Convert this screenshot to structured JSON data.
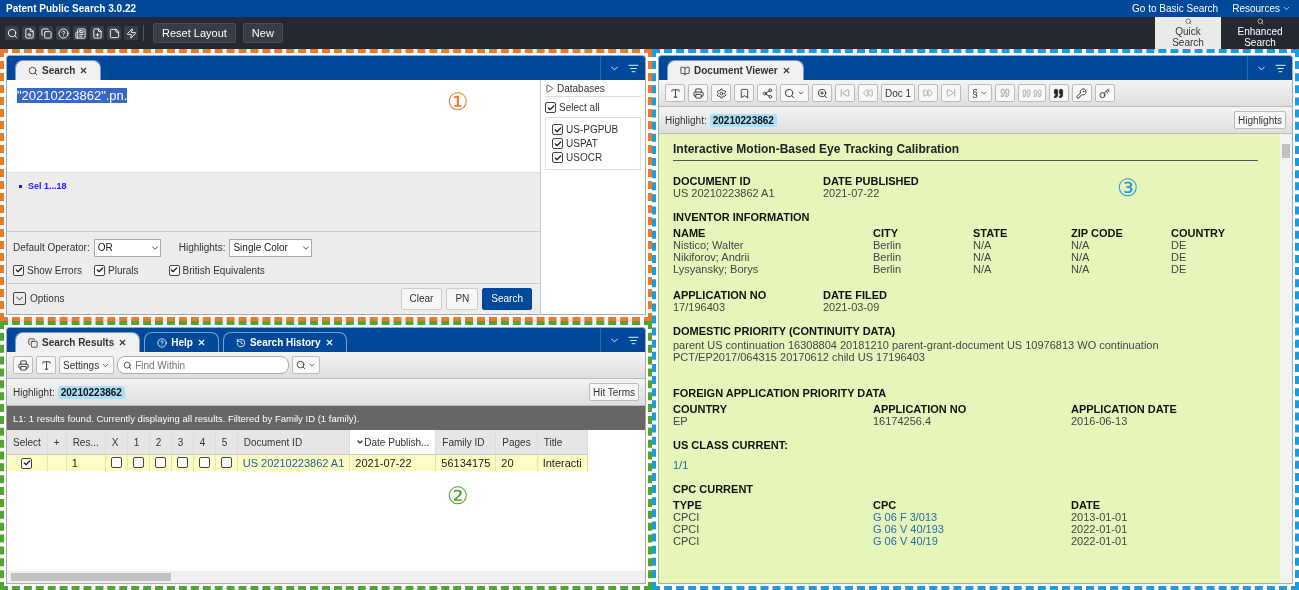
{
  "app": {
    "title": "Patent Public Search 3.0.22",
    "links": [
      "Go to Basic Search",
      "Resources"
    ]
  },
  "toolbar": {
    "buttons": [
      "Reset Layout",
      "New"
    ],
    "modes": [
      {
        "label": "Quick Search",
        "selected": true
      },
      {
        "label": "Enhanced Search",
        "selected": false
      }
    ]
  },
  "search_panel": {
    "marker": "①",
    "tabs": [
      {
        "label": "Search",
        "selected": true
      }
    ],
    "query": "\"20210223862\".pn.",
    "sets": [
      "Sel 1...18"
    ],
    "default_operator": {
      "label": "Default Operator:",
      "value": "OR"
    },
    "highlights": {
      "label": "Highlights:",
      "value": "Single Color"
    },
    "options": [
      {
        "label": "Show Errors",
        "checked": true
      },
      {
        "label": "Plurals",
        "checked": true
      },
      {
        "label": "British Equivalents",
        "checked": true
      }
    ],
    "options_toggle": "Options",
    "buttons": [
      {
        "label": "Clear",
        "primary": false
      },
      {
        "label": "PN",
        "primary": false
      },
      {
        "label": "Search",
        "primary": true
      }
    ],
    "databases": {
      "title": "Databases",
      "select_all": {
        "label": "Select all",
        "checked": true
      },
      "items": [
        {
          "label": "US-PGPUB",
          "checked": true
        },
        {
          "label": "USPAT",
          "checked": true
        },
        {
          "label": "USOCR",
          "checked": true
        }
      ]
    }
  },
  "results_panel": {
    "marker": "②",
    "tabs": [
      {
        "label": "Search Results",
        "selected": true
      },
      {
        "label": "Help",
        "selected": false
      },
      {
        "label": "Search History",
        "selected": false
      }
    ],
    "settings": "Settings",
    "find_placeholder": "Find Within",
    "highlight_label": "Highlight:",
    "highlight_term": "20210223862",
    "hit_terms": "Hit Terms",
    "status": "L1:  1 results found. Currently displaying all results. Filtered by Family ID (1 family).",
    "columns": [
      {
        "label": "Select",
        "sorted": false
      },
      {
        "label": "+",
        "sorted": false
      },
      {
        "label": "Res...",
        "sorted": false
      },
      {
        "label": "X",
        "sorted": false
      },
      {
        "label": "1",
        "sorted": false
      },
      {
        "label": "2",
        "sorted": false
      },
      {
        "label": "3",
        "sorted": false
      },
      {
        "label": "4",
        "sorted": false
      },
      {
        "label": "5",
        "sorted": false
      },
      {
        "label": "Document ID",
        "sorted": false
      },
      {
        "label": "Date Publish...",
        "sorted": true
      },
      {
        "label": "Family ID",
        "sorted": false
      },
      {
        "label": "Pages",
        "sorted": false
      },
      {
        "label": "Title",
        "sorted": false
      }
    ],
    "rows": [
      {
        "selected": true,
        "checked": true,
        "result": "1",
        "marks": [
          false,
          false,
          false,
          false,
          false,
          false
        ],
        "document_id": "US 20210223862 A1",
        "date": "2021-07-22",
        "family_id": "56134175",
        "pages": "20",
        "title": "Interacti"
      }
    ]
  },
  "viewer": {
    "marker": "③",
    "tabs": [
      {
        "label": "Document Viewer",
        "selected": true
      }
    ],
    "doc": "Doc 1",
    "section_menu": "§",
    "highlight_label": "Highlight:",
    "highlight_term": "20210223862",
    "highlights_button": "Highlights",
    "title": "Interactive Motion-Based Eye Tracking Calibration",
    "sections": [
      {
        "kind": "fields",
        "items": [
          {
            "label": "DOCUMENT ID",
            "value": "US 20210223862 A1"
          },
          {
            "label": "DATE PUBLISHED",
            "value": "2021-07-22"
          }
        ]
      },
      {
        "kind": "table",
        "title": "INVENTOR INFORMATION",
        "columns": [
          "NAME",
          "CITY",
          "STATE",
          "ZIP CODE",
          "COUNTRY"
        ],
        "rows": [
          [
            "Nistico; Walter",
            "Berlin",
            "N/A",
            "N/A",
            "DE"
          ],
          [
            "Nikiforov; Andrii",
            "Berlin",
            "N/A",
            "N/A",
            "DE"
          ],
          [
            "Lysyansky; Borys",
            "Berlin",
            "N/A",
            "N/A",
            "DE"
          ]
        ]
      },
      {
        "kind": "fields",
        "items": [
          {
            "label": "APPLICATION NO",
            "value": "17/196403"
          },
          {
            "label": "DATE FILED",
            "value": "2021-03-09"
          }
        ]
      },
      {
        "kind": "paragraph",
        "title": "DOMESTIC PRIORITY (CONTINUITY DATA)",
        "text": "parent US continuation 16308804 20181210 parent-grant-document US 10976813 WO continuation PCT/EP2017/064315 20170612 child US 17196403"
      },
      {
        "kind": "table",
        "title": "FOREIGN APPLICATION PRIORITY DATA",
        "columns": [
          "COUNTRY",
          "APPLICATION NO",
          "APPLICATION DATE"
        ],
        "rows": [
          [
            "EP",
            "16174256.4",
            "2016-06-13"
          ]
        ]
      },
      {
        "kind": "link",
        "title": "US CLASS CURRENT:",
        "text": "1/1"
      },
      {
        "kind": "cpc_table",
        "title": "CPC CURRENT",
        "columns": [
          "TYPE",
          "CPC",
          "DATE"
        ],
        "rows": [
          {
            "type": "CPCI",
            "cpc": "G 06 F 3/013",
            "date": "2013-01-01"
          },
          {
            "type": "CPCI",
            "cpc": "G 06 V 40/193",
            "date": "2022-01-01"
          },
          {
            "type": "CPCI",
            "cpc": "G 06 V 40/19",
            "date": "2022-01-01"
          }
        ]
      }
    ]
  }
}
